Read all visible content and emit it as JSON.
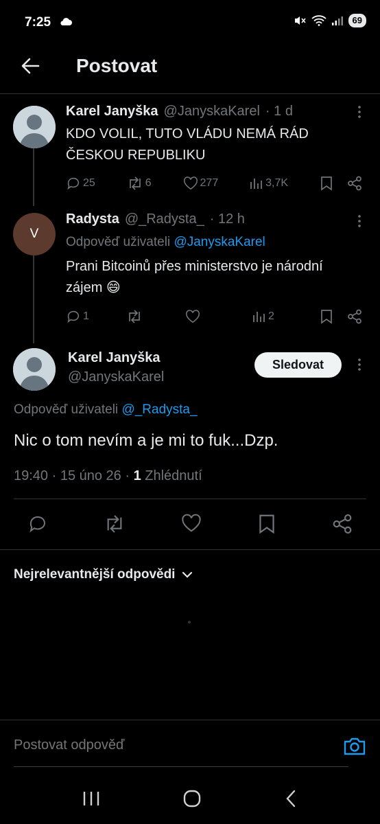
{
  "status_bar": {
    "time": "7:25",
    "battery": "69"
  },
  "header": {
    "title": "Postovat"
  },
  "tweet1": {
    "name": "Karel Janyška",
    "handle": "@JanyskaKarel",
    "time": "· 1 d",
    "text": "KDO VOLIL, TUTO VLÁDU NEMÁ RÁD ČESKOU REPUBLIKU",
    "replies": "25",
    "retweets": "6",
    "likes": "277",
    "views": "3,7K"
  },
  "tweet2": {
    "avatar_letter": "V",
    "name": "Radysta",
    "handle": "@_Radysta_",
    "time": "· 12 h",
    "reply_prefix": "Odpověď uživateli",
    "reply_handle": "@JanyskaKarel",
    "text": "Prani Bitcoinů přes ministerstvo je národní zájem 😄",
    "replies": "1",
    "views": "2"
  },
  "main_tweet": {
    "name": "Karel Janyška",
    "handle": "@JanyskaKarel",
    "follow_label": "Sledovat",
    "reply_prefix": "Odpověď uživateli",
    "reply_handle": "@_Radysta_",
    "text": "Nic o tom nevím a je mi to fuk...Dzp.",
    "datetime": "19:40 · 15 úno 26 · ",
    "views_count": "1",
    "views_label": " Zhlédnutí"
  },
  "sort": {
    "label": "Nejrelevantnější odpovědi"
  },
  "reply_box": {
    "placeholder": "Postovat odpověď"
  },
  "colors": {
    "background": "#000000",
    "accent": "#1d9bf0",
    "muted": "#71767b",
    "text": "#e7e9ea"
  }
}
